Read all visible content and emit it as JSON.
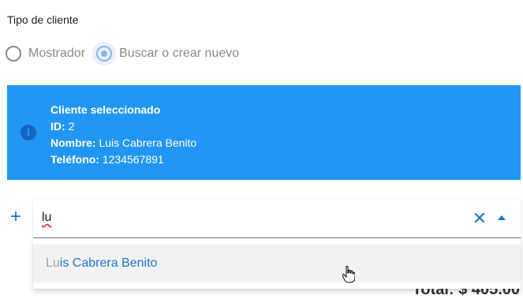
{
  "tipo_cliente": {
    "label": "Tipo de cliente",
    "options": [
      {
        "label": "Mostrador",
        "checked": false
      },
      {
        "label": "Buscar o crear nuevo",
        "checked": true
      }
    ]
  },
  "alert": {
    "title": "Cliente seleccionado",
    "id_label": "ID:",
    "id_value": "2",
    "nombre_label": "Nombre:",
    "nombre_value": "Luis Cabrera Benito",
    "telefono_label": "Teléfono:",
    "telefono_value": "1234567891",
    "icon": "info-icon"
  },
  "search": {
    "value": "lu",
    "clear_icon": "close-icon",
    "toggle_icon": "arrow-up-icon",
    "add_icon": "plus-icon"
  },
  "suggestions": [
    {
      "match": "Lu",
      "rest": "is Cabrera Benito"
    }
  ],
  "footer_peek": "Total: $ 405.00",
  "colors": {
    "primary": "#1976d2",
    "alert_bg": "#2196f3",
    "radio_checked": "#8ab4f0"
  }
}
